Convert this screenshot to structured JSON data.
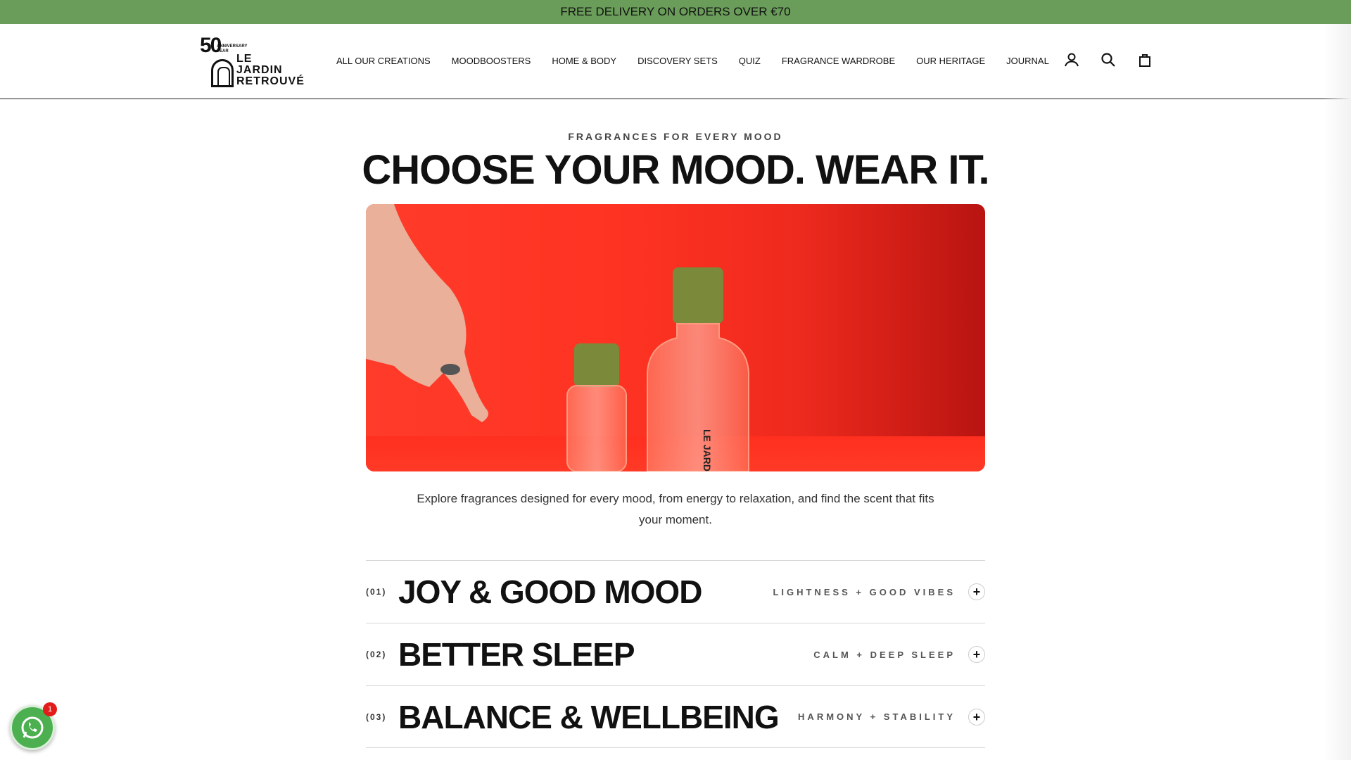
{
  "announcement": {
    "text": "FREE DELIVERY ON ORDERS OVER €70"
  },
  "logo": {
    "anniversary_number": "50",
    "anniversary_text": "ANNIVERSARY YEAR",
    "brand": "LE\nJARDIN\nRETROUVÉ"
  },
  "nav": {
    "items": [
      {
        "label": "ALL OUR CREATIONS"
      },
      {
        "label": "MOODBOOSTERS"
      },
      {
        "label": "HOME & BODY"
      },
      {
        "label": "DISCOVERY SETS"
      },
      {
        "label": "QUIZ"
      },
      {
        "label": "FRAGRANCE WARDROBE"
      },
      {
        "label": "OUR HERITAGE"
      },
      {
        "label": "JOURNAL"
      }
    ]
  },
  "header_icons": [
    "account-icon",
    "search-icon",
    "cart-icon"
  ],
  "hero": {
    "eyebrow": "FRAGRANCES FOR EVERY MOOD",
    "headline": "CHOOSE YOUR MOOD. WEAR IT.",
    "bottle_label": "LE JARDIN RETROUVÉ",
    "intro": "Explore fragrances designed for every mood, from energy to relaxation, and find the scent that fits your moment.",
    "colors": {
      "background": "#ff3322",
      "cap": "#7a8a3a"
    }
  },
  "moods": [
    {
      "number": "(01)",
      "title": "JOY & GOOD MOOD",
      "tagline": "LIGHTNESS + GOOD VIBES"
    },
    {
      "number": "(02)",
      "title": "BETTER SLEEP",
      "tagline": "CALM + DEEP SLEEP"
    },
    {
      "number": "(03)",
      "title": "BALANCE & WELLBEING",
      "tagline": "HARMONY + STABILITY"
    }
  ],
  "whatsapp": {
    "badge_count": "1"
  },
  "colors": {
    "announcement_bg": "#6a9d5a",
    "whatsapp": "#4caf50",
    "badge": "#e21b1b"
  }
}
